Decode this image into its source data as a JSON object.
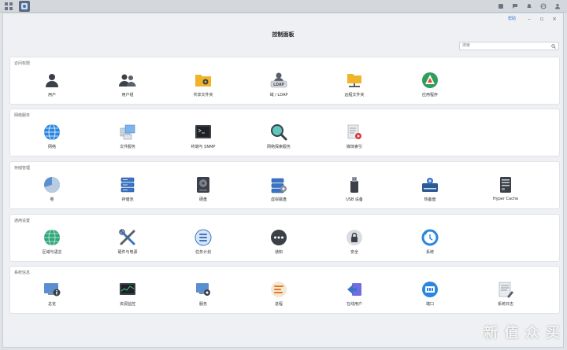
{
  "window": {
    "title": "控制面板",
    "help_label": "帮助",
    "search_placeholder": "搜索"
  },
  "sections": [
    {
      "title": "访问权限",
      "items": [
        {
          "label": "用户",
          "icon": "user-icon"
        },
        {
          "label": "用户组",
          "icon": "user-group-icon"
        },
        {
          "label": "共享文件夹",
          "icon": "shared-folder-icon"
        },
        {
          "label": "域 / LDAP",
          "icon": "domain-ldap-icon"
        },
        {
          "label": "远程文件夹",
          "icon": "remote-folder-icon"
        },
        {
          "label": "应用程序",
          "icon": "application-icon"
        }
      ]
    },
    {
      "title": "网络服务",
      "items": [
        {
          "label": "网络",
          "icon": "network-globe-icon"
        },
        {
          "label": "文件服务",
          "icon": "file-services-icon"
        },
        {
          "label": "终端与 SNMP",
          "icon": "terminal-icon"
        },
        {
          "label": "网络探索服务",
          "icon": "discovery-search-icon"
        },
        {
          "label": "媒体索引",
          "icon": "media-index-icon"
        }
      ]
    },
    {
      "title": "存储管理",
      "items": [
        {
          "label": "卷",
          "icon": "volume-pie-icon"
        },
        {
          "label": "存储池",
          "icon": "storage-pool-icon"
        },
        {
          "label": "硬盘",
          "icon": "hard-disk-icon"
        },
        {
          "label": "虚拟磁盘",
          "icon": "virtual-disk-icon"
        },
        {
          "label": "USB 设备",
          "icon": "usb-device-icon"
        },
        {
          "label": "热备盘",
          "icon": "hot-spare-icon"
        },
        {
          "label": "Hyper Cache",
          "icon": "hyper-cache-icon"
        }
      ]
    },
    {
      "title": "通用设置",
      "items": [
        {
          "label": "区域与语言",
          "icon": "region-language-icon"
        },
        {
          "label": "硬件与电源",
          "icon": "hardware-tools-icon"
        },
        {
          "label": "任务计划",
          "icon": "task-scheduler-icon"
        },
        {
          "label": "通知",
          "icon": "notification-icon"
        },
        {
          "label": "安全",
          "icon": "security-lock-icon"
        },
        {
          "label": "系统",
          "icon": "system-update-icon"
        }
      ]
    },
    {
      "title": "系统信息",
      "items": [
        {
          "label": "总览",
          "icon": "overview-icon"
        },
        {
          "label": "资源监控",
          "icon": "resource-monitor-icon"
        },
        {
          "label": "服务",
          "icon": "services-icon"
        },
        {
          "label": "进程",
          "icon": "process-icon"
        },
        {
          "label": "在线用户",
          "icon": "online-users-icon"
        },
        {
          "label": "端口",
          "icon": "ports-icon"
        },
        {
          "label": "系统日志",
          "icon": "system-log-icon"
        }
      ]
    }
  ],
  "watermark": "新 值 众 买",
  "colors": {
    "accent": "#3a74c8",
    "background": "#eef0f3"
  }
}
